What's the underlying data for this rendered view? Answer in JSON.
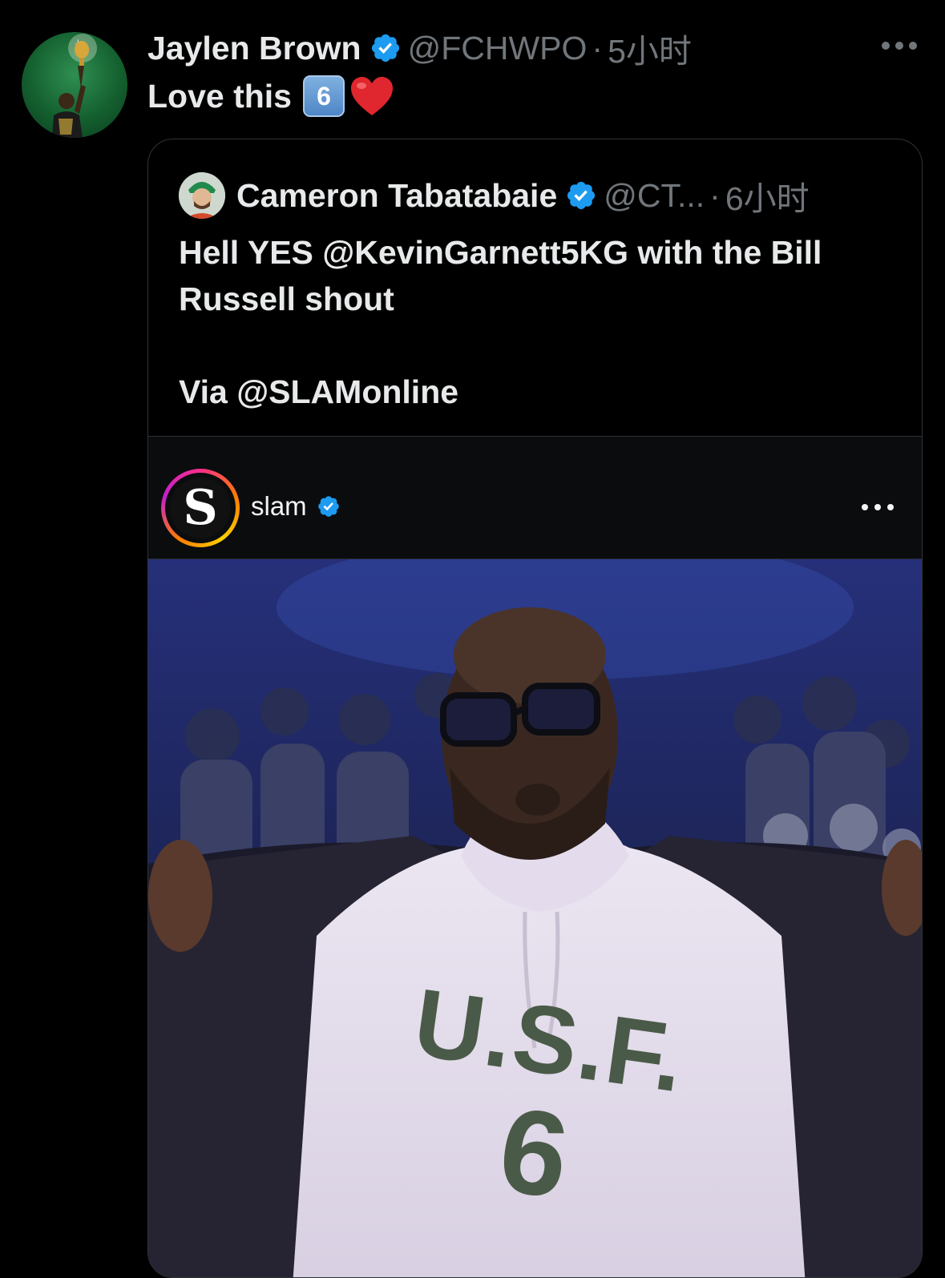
{
  "tweet": {
    "author_name": "Jaylen Brown",
    "handle": "@FCHWPO",
    "separator": "·",
    "time": "5小时",
    "text": "Love this",
    "keycap_emoji": "6",
    "heart_emoji": "red-heart",
    "avatar_icon": "player-trophy-avatar",
    "verified_icon": "verified-badge-icon",
    "more_icon": "more-options-icon"
  },
  "quoted": {
    "author_name": "Cameron Tabatabaie",
    "handle": "@CT...",
    "separator": "·",
    "time": "6小时",
    "line1": "Hell YES @KevinGarnett5KG with the Bill",
    "line2": "Russell shout",
    "line3": "Via @SLAMonline",
    "avatar_icon": "user-avatar"
  },
  "instagram": {
    "account": "slam",
    "logo_letter": "S",
    "verified_icon": "verified-badge-icon",
    "more_icon": "more-options-icon"
  },
  "video_frame": {
    "shirt_line1": "U.S.F.",
    "shirt_line2": "6"
  },
  "colors": {
    "background": "#000000",
    "text_primary": "#e7e9ea",
    "text_secondary": "#71767b",
    "verified_blue": "#1d9bf0",
    "border": "#2f3336",
    "shirt_text": "#4a5a48"
  }
}
